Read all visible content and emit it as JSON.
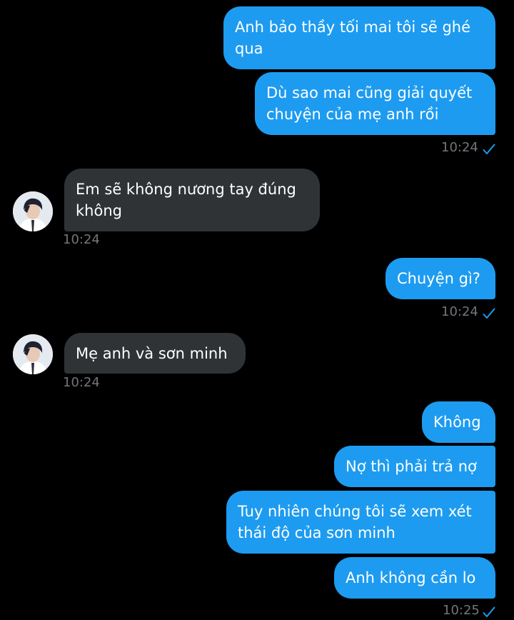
{
  "colors": {
    "background": "#000000",
    "outgoing_bubble": "#1d9bf0",
    "incoming_bubble": "#2f3336",
    "timestamp": "#71767b",
    "read_check": "#1d9bf0"
  },
  "messages": [
    {
      "direction": "outgoing",
      "text": "Anh bảo thầy tối mai tôi sẽ ghé\nqua"
    },
    {
      "direction": "outgoing",
      "text": "Dù sao mai cũng giải quyết\nchuyện của mẹ anh rồi",
      "time": "10:24",
      "status_icon": "read-check-icon"
    },
    {
      "direction": "incoming",
      "text": "Em sẽ không nương tay đúng\nkhông",
      "time": "10:24",
      "avatar": "contact-avatar"
    },
    {
      "direction": "outgoing",
      "text": "Chuyện gì?",
      "time": "10:24",
      "status_icon": "read-check-icon"
    },
    {
      "direction": "incoming",
      "text": "Mẹ anh và sơn minh",
      "time": "10:24",
      "avatar": "contact-avatar"
    },
    {
      "direction": "outgoing",
      "text": "Không"
    },
    {
      "direction": "outgoing",
      "text": "Nợ thì phải trả nợ"
    },
    {
      "direction": "outgoing",
      "text": "Tuy nhiên chúng tôi sẽ xem xét\nthái độ của sơn minh"
    },
    {
      "direction": "outgoing",
      "text": "Anh không cần lo",
      "time": "10:25",
      "status_icon": "read-check-icon"
    }
  ]
}
